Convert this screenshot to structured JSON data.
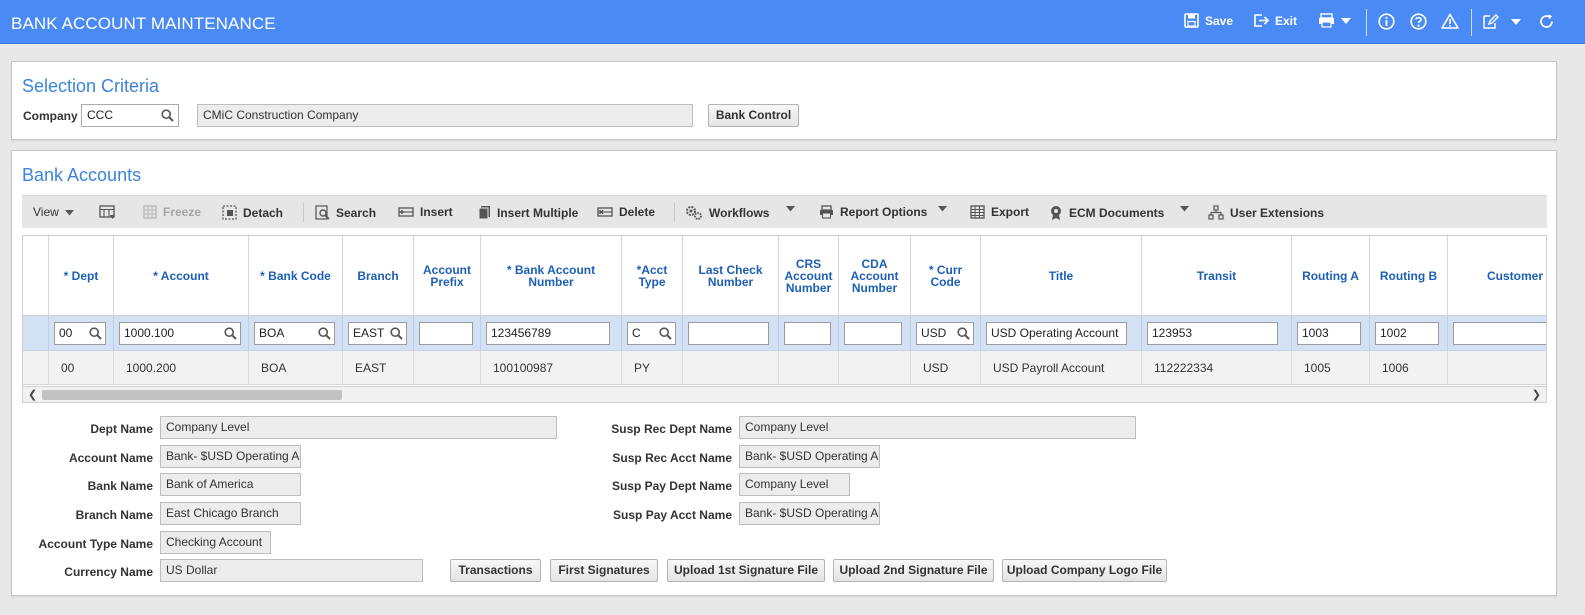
{
  "app": {
    "title": "BANK ACCOUNT MAINTENANCE"
  },
  "topbar": {
    "save": "Save",
    "exit": "Exit"
  },
  "selection": {
    "title": "Selection Criteria",
    "company_label": "Company",
    "company_value": "CCC",
    "company_name": "CMiC Construction Company",
    "bank_control": "Bank Control"
  },
  "bank_accounts": {
    "title": "Bank Accounts",
    "toolbar": {
      "view": "View",
      "freeze": "Freeze",
      "detach": "Detach",
      "search": "Search",
      "insert": "Insert",
      "insert_multiple": "Insert Multiple",
      "delete": "Delete",
      "workflows": "Workflows",
      "report_options": "Report Options",
      "export": "Export",
      "ecm_documents": "ECM Documents",
      "user_extensions": "User Extensions"
    },
    "columns": [
      "* Dept",
      "* Account",
      "* Bank Code",
      "Branch",
      "Account Prefix",
      "* Bank Account Number",
      "*Acct Type",
      "Last Check Number",
      "CRS Account Number",
      "CDA Account Number",
      "* Curr Code",
      "Title",
      "Transit",
      "Routing A",
      "Routing B",
      "Customer"
    ],
    "filter_row": [
      "00",
      "1000.100",
      "BOA",
      "EAST",
      "",
      "123456789",
      "C",
      "",
      "",
      "",
      "USD",
      "USD Operating Account",
      "123953",
      "1003",
      "1002",
      ""
    ],
    "rows": [
      [
        "00",
        "1000.200",
        "BOA",
        "EAST",
        "",
        "100100987",
        "PY",
        "",
        "",
        "",
        "USD",
        "USD Payroll Account",
        "112222334",
        "1005",
        "1006",
        ""
      ]
    ]
  },
  "details": {
    "dept_name_label": "Dept Name",
    "dept_name": "Company Level",
    "account_name_label": "Account Name",
    "account_name": "Bank- $USD Operating Account",
    "bank_name_label": "Bank Name",
    "bank_name": "Bank of America",
    "branch_name_label": "Branch Name",
    "branch_name": "East Chicago Branch",
    "account_type_label": "Account Type Name",
    "account_type": "Checking Account",
    "currency_label": "Currency Name",
    "currency": "US Dollar",
    "susp_rec_dept_label": "Susp Rec Dept Name",
    "susp_rec_dept": "Company Level",
    "susp_rec_acct_label": "Susp Rec Acct Name",
    "susp_rec_acct": "Bank- $USD Operating Account",
    "susp_pay_dept_label": "Susp Pay Dept Name",
    "susp_pay_dept": "Company Level",
    "susp_pay_acct_label": "Susp Pay Acct Name",
    "susp_pay_acct": "Bank- $USD Operating Account"
  },
  "actions": {
    "transactions": "Transactions",
    "first_signatures": "First Signatures",
    "upload_1st": "Upload 1st Signature File",
    "upload_2nd": "Upload 2nd Signature File",
    "upload_logo": "Upload Company Logo File"
  }
}
